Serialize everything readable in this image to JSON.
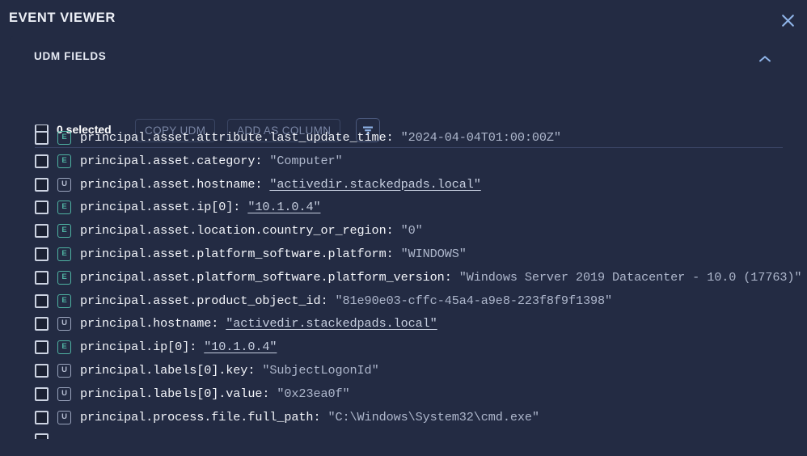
{
  "dialog": {
    "title": "EVENT VIEWER",
    "close_icon": "close-icon"
  },
  "panel": {
    "title": "UDM FIELDS",
    "collapse_icon": "chevron-up-icon"
  },
  "toolbar": {
    "selected_label": "0 selected",
    "copy_udm_label": "COPY UDM",
    "add_as_column_label": "ADD AS COLUMN",
    "filter_icon": "filter-icon"
  },
  "colors": {
    "dialog_bg": "#232b43",
    "page_bg": "#12151f",
    "accent_link": "#8fb4e8",
    "badge_event": "#4fb3a3",
    "badge_udm": "#9aa4bd",
    "key_text": "#f2f4f9",
    "value_text": "#aeb7cc",
    "divider": "#3a4464"
  },
  "fields": [
    {
      "badge": "E",
      "key": "principal.asset.attribute.last_update_time: ",
      "value": "\"2024-04-04T01:00:00Z\"",
      "link": false
    },
    {
      "badge": "E",
      "key": "principal.asset.category: ",
      "value": "\"Computer\"",
      "link": false
    },
    {
      "badge": "U",
      "key": "principal.asset.hostname: ",
      "value": "\"activedir.stackedpads.local\"",
      "link": true
    },
    {
      "badge": "E",
      "key": "principal.asset.ip[0]: ",
      "value": "\"10.1.0.4\"",
      "link": true
    },
    {
      "badge": "E",
      "key": "principal.asset.location.country_or_region: ",
      "value": "\"0\"",
      "link": false
    },
    {
      "badge": "E",
      "key": "principal.asset.platform_software.platform: ",
      "value": "\"WINDOWS\"",
      "link": false
    },
    {
      "badge": "E",
      "key": "principal.asset.platform_software.platform_version: ",
      "value": "\"Windows Server 2019 Datacenter - 10.0 (17763)\"",
      "link": false
    },
    {
      "badge": "E",
      "key": "principal.asset.product_object_id: ",
      "value": "\"81e90e03-cffc-45a4-a9e8-223f8f9f1398\"",
      "link": false
    },
    {
      "badge": "U",
      "key": "principal.hostname: ",
      "value": "\"activedir.stackedpads.local\"",
      "link": true
    },
    {
      "badge": "E",
      "key": "principal.ip[0]: ",
      "value": "\"10.1.0.4\"",
      "link": true
    },
    {
      "badge": "U",
      "key": "principal.labels[0].key: ",
      "value": "\"SubjectLogonId\"",
      "link": false
    },
    {
      "badge": "U",
      "key": "principal.labels[0].value: ",
      "value": "\"0x23ea0f\"",
      "link": false
    },
    {
      "badge": "U",
      "key": "principal.process.file.full_path: ",
      "value": "\"C:\\Windows\\System32\\cmd.exe\"",
      "link": false
    }
  ]
}
